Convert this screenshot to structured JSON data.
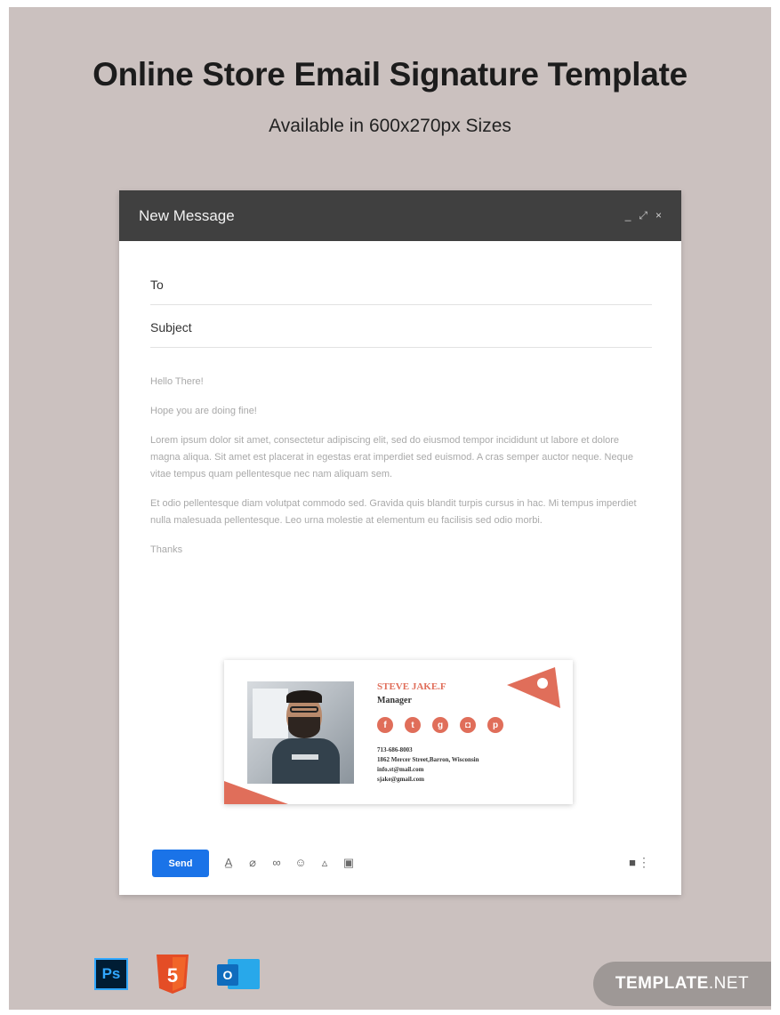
{
  "header": {
    "title": "Online Store Email Signature Template",
    "subtitle": "Available in 600x270px Sizes"
  },
  "compose": {
    "window_title": "New Message",
    "controls": {
      "minimize": "_",
      "expand": "⤢",
      "close": "×"
    },
    "to_label": "To",
    "subject_label": "Subject",
    "body": [
      "Hello There!",
      "Hope you are doing fine!",
      "Lorem ipsum dolor sit amet, consectetur adipiscing elit, sed do eiusmod tempor incididunt ut labore et dolore magna aliqua. Sit amet est placerat in egestas erat imperdiet sed euismod. A cras semper auctor neque. Neque vitae tempus quam pellentesque nec nam aliquam sem.",
      "Et odio pellentesque diam volutpat commodo sed. Gravida quis blandit turpis cursus in hac. Mi tempus imperdiet nulla malesuada pellentesque. Leo urna molestie at elementum eu facilisis sed odio morbi.",
      "Thanks"
    ],
    "send_label": "Send"
  },
  "signature": {
    "name": "STEVE JAKE.F",
    "role": "Manager",
    "phone": "713-686-8003",
    "address": "1862 Mercer Street,Barron, Wisconsin",
    "email1": "info.st@mail.com",
    "email2": "sjake@gmail.com",
    "social_icons": [
      "facebook-icon",
      "twitter-icon",
      "google-plus-icon",
      "instagram-icon",
      "pinterest-icon"
    ],
    "accent": "#e06e5a"
  },
  "toolbar_icons": [
    "format-text-icon",
    "attach-icon",
    "link-icon",
    "emoji-icon",
    "drive-icon",
    "photo-icon"
  ],
  "apps": {
    "photoshop": "Ps",
    "html5": "5",
    "outlook": "O"
  },
  "badge": {
    "brand": "TEMPLATE",
    "tld": ".NET"
  },
  "colors": {
    "background": "#cbc1bf",
    "titlebar": "#404040",
    "send": "#1a73e8"
  }
}
